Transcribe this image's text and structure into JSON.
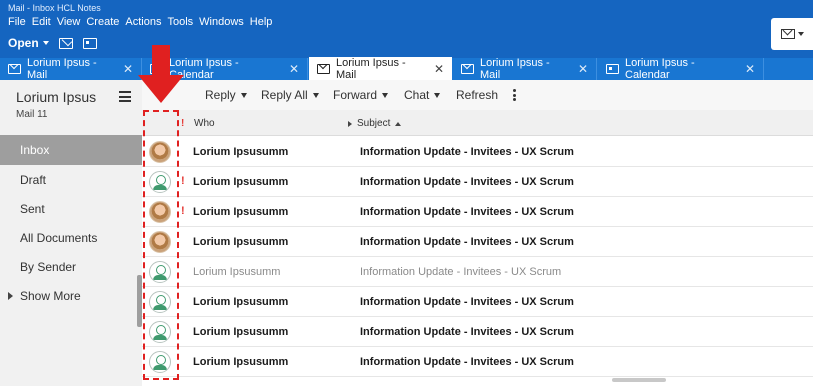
{
  "window": {
    "title": "Mail - Inbox HCL Notes"
  },
  "menu": [
    "File",
    "Edit",
    "View",
    "Create",
    "Actions",
    "Tools",
    "Windows",
    "Help"
  ],
  "toolbar": {
    "open_label": "Open"
  },
  "tabs": [
    {
      "label": "Lorium Ipsus - Mail",
      "icon": "mail-icon",
      "active": false
    },
    {
      "label": "Lorium Ipsus - Calendar",
      "icon": "calendar-icon",
      "active": false
    },
    {
      "label": "Lorium Ipsus - Mail",
      "icon": "mail-icon",
      "active": true
    },
    {
      "label": "Lorium Ipsus - Mail",
      "icon": "mail-icon",
      "active": false
    },
    {
      "label": "Lorium Ipsus - Calendar",
      "icon": "calendar-icon",
      "active": false
    }
  ],
  "tab_close_glyph": "✕",
  "sidebar": {
    "account_name": "Lorium Ipsus",
    "account_sub": "Mail 11",
    "items": [
      {
        "label": "Inbox",
        "selected": true
      },
      {
        "label": "Draft"
      },
      {
        "label": "Sent"
      },
      {
        "label": "All Documents"
      },
      {
        "label": "By Sender"
      },
      {
        "label": "Show More",
        "expandable": true
      }
    ]
  },
  "actions": {
    "reply": "Reply",
    "reply_all": "Reply All",
    "forward": "Forward",
    "chat": "Chat",
    "refresh": "Refresh"
  },
  "list": {
    "header": {
      "priority_flag": "!",
      "who": "Who",
      "subject": "Subject"
    },
    "rows": [
      {
        "avatar": "photo",
        "priority": "",
        "who": "Lorium Ipsusumm",
        "subject": "Information Update - Invitees - UX Scrum",
        "unread": true
      },
      {
        "avatar": "generic",
        "priority": "!",
        "who": "Lorium Ipsusumm",
        "subject": "Information Update - Invitees - UX Scrum",
        "unread": true
      },
      {
        "avatar": "photo",
        "priority": "!",
        "who": "Lorium Ipsusumm",
        "subject": "Information Update - Invitees - UX Scrum",
        "unread": true
      },
      {
        "avatar": "photo",
        "priority": "",
        "who": "Lorium Ipsusumm",
        "subject": "Information Update - Invitees - UX Scrum",
        "unread": true
      },
      {
        "avatar": "generic",
        "priority": "",
        "who": "Lorium Ipsusumm",
        "subject": "Information Update - Invitees - UX Scrum",
        "unread": false
      },
      {
        "avatar": "generic",
        "priority": "",
        "who": "Lorium Ipsusumm",
        "subject": "Information Update - Invitees - UX Scrum",
        "unread": true
      },
      {
        "avatar": "generic",
        "priority": "",
        "who": "Lorium Ipsusumm",
        "subject": "Information Update - Invitees - UX Scrum",
        "unread": true
      },
      {
        "avatar": "generic",
        "priority": "",
        "who": "Lorium Ipsusumm",
        "subject": "Information Update - Invitees - UX Scrum",
        "unread": true
      }
    ]
  },
  "colors": {
    "brand": "#1565c0",
    "tab_strip": "#1976d2",
    "annotation": "#e02020",
    "priority": "#e53935",
    "nav_selected": "#9e9e9e"
  }
}
